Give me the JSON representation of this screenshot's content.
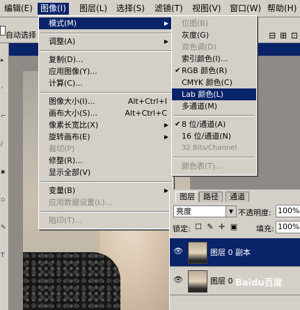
{
  "menubar": {
    "items": [
      {
        "label": "编辑(E)"
      },
      {
        "label": "图像(I)"
      },
      {
        "label": "图层(L)"
      },
      {
        "label": "选择(S)"
      },
      {
        "label": "滤镜(T)"
      },
      {
        "label": "视图(V)"
      },
      {
        "label": "窗口(W)"
      },
      {
        "label": "帮助(H)"
      }
    ]
  },
  "options_bar": {
    "auto_select_label": "自动选择"
  },
  "image_menu": {
    "mode": "模式(M)",
    "adjust": "调整(A)",
    "duplicate": "复制(D)...",
    "apply_image": "应用图像(Y)...",
    "calculations": "计算(C)...",
    "image_size": "图像大小(I)...",
    "image_size_sc": "Alt+Ctrl+I",
    "canvas_size": "画布大小(S)...",
    "canvas_size_sc": "Alt+Ctrl+C",
    "pixel_aspect": "像素长宽比(X)",
    "rotate_canvas": "旋转画布(E)",
    "crop": "裁切(P)",
    "trim": "修整(R)...",
    "reveal_all": "显示全部(V)",
    "variables": "变量(B)",
    "apply_dataset": "应用数据设置(L)...",
    "trap": "陷印(T)..."
  },
  "mode_menu": {
    "bitmap": "位图(B)",
    "grayscale": "灰度(G)",
    "duotone": "双色调(D)",
    "indexed": "索引颜色(I)...",
    "rgb": "RGB 颜色(R)",
    "cmyk": "CMYK 颜色(C)",
    "lab": "Lab 颜色(L)",
    "multichannel": "多通道(M)",
    "bit8": "8 位/通道(A)",
    "bit16": "16 位/通道(N)",
    "bit32": "32 Bits/Channel",
    "color_table": "颜色表(T)..."
  },
  "layers_panel": {
    "tabs": [
      {
        "label": "图层"
      },
      {
        "label": "路径"
      },
      {
        "label": "通道"
      }
    ],
    "blend_mode": "亮度",
    "opacity_label": "不透明度:",
    "opacity_value": "100%",
    "lock_label": "锁定:",
    "fill_label": "填充:",
    "fill_value": "100%",
    "layers": [
      {
        "name": "图层 0 副本"
      },
      {
        "name": "图层 0"
      }
    ]
  },
  "watermark": "Baidu百度",
  "colors": {
    "highlight": "#0a246a",
    "menu_bg": "#d4d0c8",
    "disabled": "#8a877f"
  }
}
